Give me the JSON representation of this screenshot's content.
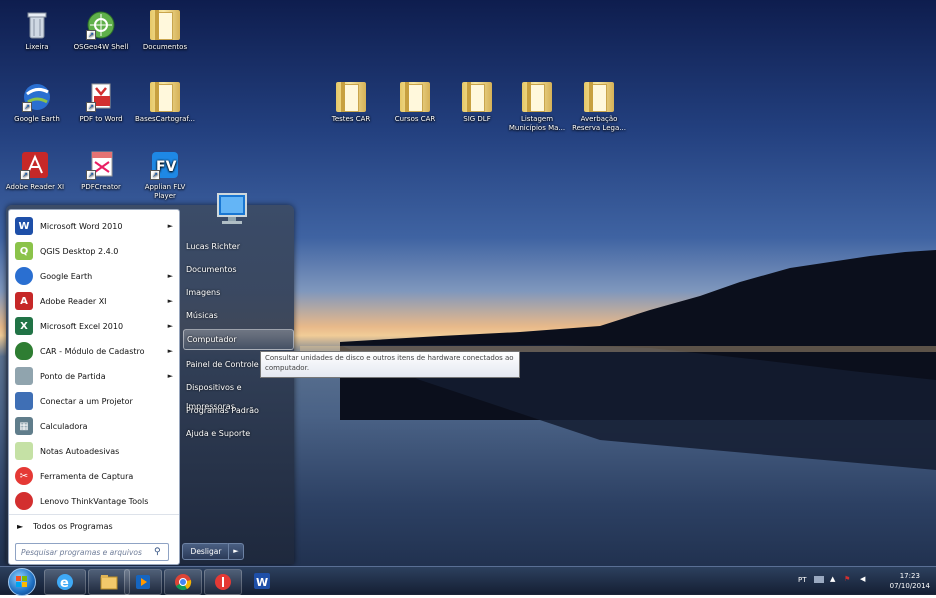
{
  "desktop_icons": [
    {
      "label": "Lixeira",
      "icon": "recycle-bin-icon"
    },
    {
      "label": "OSGeo4W Shell",
      "icon": "osgeo-icon"
    },
    {
      "label": "Documentos",
      "icon": "folder-icon"
    },
    {
      "label": "Google Earth",
      "icon": "google-earth-icon"
    },
    {
      "label": "PDF to Word",
      "icon": "pdf-to-word-icon"
    },
    {
      "label": "BasesCartograf...",
      "icon": "folder-icon"
    },
    {
      "label": "Testes CAR",
      "icon": "folder-icon"
    },
    {
      "label": "Cursos CAR",
      "icon": "folder-icon"
    },
    {
      "label": "SIG DLF",
      "icon": "folder-icon"
    },
    {
      "label": "Listagem Municípios Ma...",
      "icon": "folder-icon"
    },
    {
      "label": "Averbação Reserva Lega...",
      "icon": "folder-icon"
    },
    {
      "label": "Adobe Reader XI",
      "icon": "adobe-reader-icon"
    },
    {
      "label": "PDFCreator",
      "icon": "pdfcreator-icon"
    },
    {
      "label": "Applian FLV Player",
      "icon": "flv-player-icon"
    }
  ],
  "start_menu": {
    "programs": [
      {
        "label": "Microsoft Word 2010",
        "arrow": "►"
      },
      {
        "label": "QGIS Desktop 2.4.0",
        "arrow": ""
      },
      {
        "label": "Google Earth",
        "arrow": "►"
      },
      {
        "label": "Adobe Reader XI",
        "arrow": "►"
      },
      {
        "label": "Microsoft Excel 2010",
        "arrow": "►"
      },
      {
        "label": "CAR - Módulo de Cadastro",
        "arrow": "►"
      },
      {
        "label": "Ponto de Partida",
        "arrow": "►"
      },
      {
        "label": "Conectar a um Projetor",
        "arrow": ""
      },
      {
        "label": "Calculadora",
        "arrow": ""
      },
      {
        "label": "Notas Autoadesivas",
        "arrow": ""
      },
      {
        "label": "Ferramenta de Captura",
        "arrow": ""
      },
      {
        "label": "Lenovo ThinkVantage Tools",
        "arrow": ""
      }
    ],
    "all_programs": "Todos os Programas",
    "all_programs_arrow": "►",
    "search_placeholder": "Pesquisar programas e arquivos",
    "right_items": [
      "Lucas Richter",
      "Documentos",
      "Imagens",
      "Músicas",
      "Computador",
      "Painel de Controle",
      "Dispositivos e Impressoras",
      "Programas Padrão",
      "Ajuda e Suporte"
    ],
    "shutdown_label": "Desligar",
    "shutdown_arrow": "►",
    "tooltip": "Consultar unidades de disco e outros itens de hardware conectados ao computador."
  },
  "taskbar": {
    "language": "PT",
    "time": "17:23",
    "date": "07/10/2014",
    "tray_arrow": "▲",
    "volume_glyph": "◀"
  }
}
